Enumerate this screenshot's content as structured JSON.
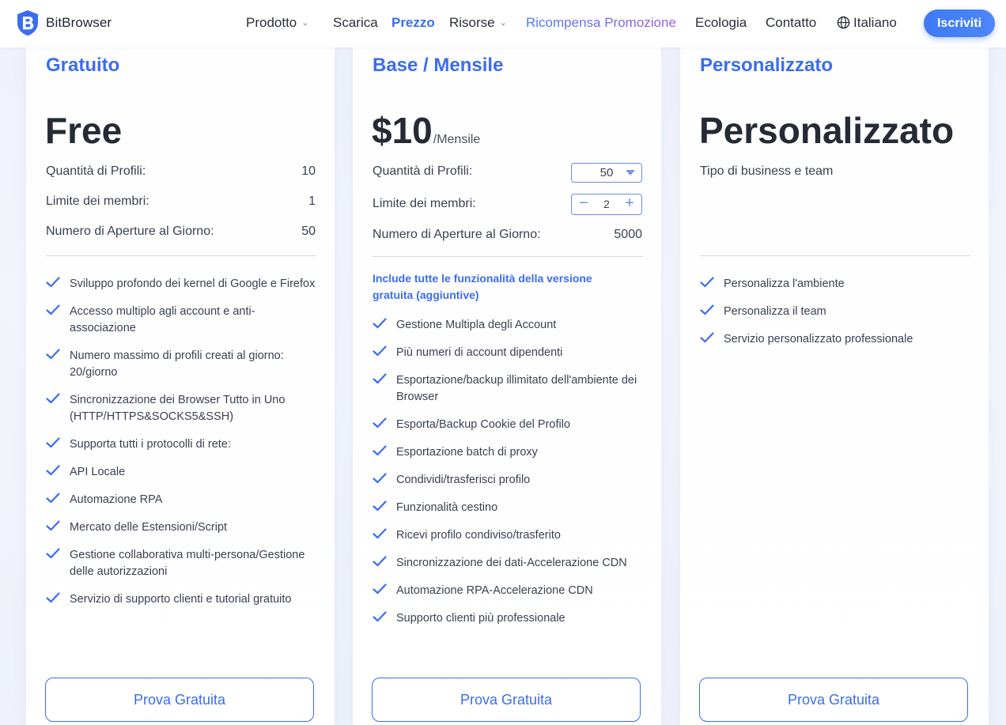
{
  "header": {
    "brand": "BitBrowser",
    "nav": [
      {
        "label": "Prodotto",
        "dropdown": true
      },
      {
        "label": "Scarica",
        "dropdown": false
      },
      {
        "label": "Prezzo",
        "dropdown": false,
        "active": true
      },
      {
        "label": "Risorse",
        "dropdown": true
      },
      {
        "label": "Ricompensa Promozione",
        "dropdown": false
      },
      {
        "label": "Ecologia",
        "dropdown": false
      },
      {
        "label": "Contatto",
        "dropdown": false
      }
    ],
    "language": "Italiano",
    "signup": "Iscriviti"
  },
  "colors": {
    "accent": "#3a6df0",
    "text": "#3b4150",
    "promo_start": "#4a7bf0",
    "promo_end": "#9b5be8"
  },
  "plans": [
    {
      "title": "Gratuito",
      "price": "Free",
      "rows": [
        {
          "label": "Quantità di Profili:",
          "value": "10"
        },
        {
          "label": "Limite dei membri:",
          "value": "1"
        },
        {
          "label": "Numero di Aperture al Giorno:",
          "value": "50"
        }
      ],
      "features": [
        "Sviluppo profondo dei kernel di Google e Firefox",
        "Accesso multiplo agli account e anti-associazione",
        "Numero massimo di profili creati al giorno: 20/giorno",
        "Sincronizzazione dei Browser Tutto in Uno (HTTP/HTTPS&SOCKS5&SSH)",
        "Supporta tutti i protocolli di rete:",
        "API Locale",
        "Automazione RPA",
        "Mercato delle Estensioni/Script",
        "Gestione collaborativa multi-persona/Gestione delle autorizzazioni",
        "Servizio di supporto clienti e tutorial gratuito"
      ],
      "button": "Prova Gratuita"
    },
    {
      "title": "Base / Mensile",
      "price": "$10",
      "price_suffix": "/Mensile",
      "rows": [
        {
          "label": "Quantità di Profili:",
          "value": "50"
        },
        {
          "label": "Limite dei membri:",
          "value": "2"
        },
        {
          "label": "Numero di Aperture al Giorno:",
          "value": "5000"
        }
      ],
      "highlight": "Include tutte le funzionalità della versione gratuita (aggiuntive)",
      "features": [
        "Gestione Multipla degli Account",
        "Più numeri di account dipendenti",
        "Esportazione/backup illimitato dell'ambiente dei Browser",
        "Esporta/Backup Cookie del Profilo",
        "Esportazione batch di proxy",
        "Condividi/trasferisci profilo",
        "Funzionalità cestino",
        "Ricevi profilo condiviso/trasferito",
        "Sincronizzazione dei dati-Accelerazione CDN",
        "Automazione RPA-Accelerazione CDN",
        "Supporto clienti più professionale"
      ],
      "button": "Prova Gratuita"
    },
    {
      "title": "Personalizzato",
      "price": "Personalizzato",
      "subtitle": "Tipo di business e team",
      "features": [
        "Personalizza l'ambiente",
        "Personalizza il team",
        "Servizio personalizzato professionale"
      ],
      "button": "Prova Gratuita"
    }
  ]
}
